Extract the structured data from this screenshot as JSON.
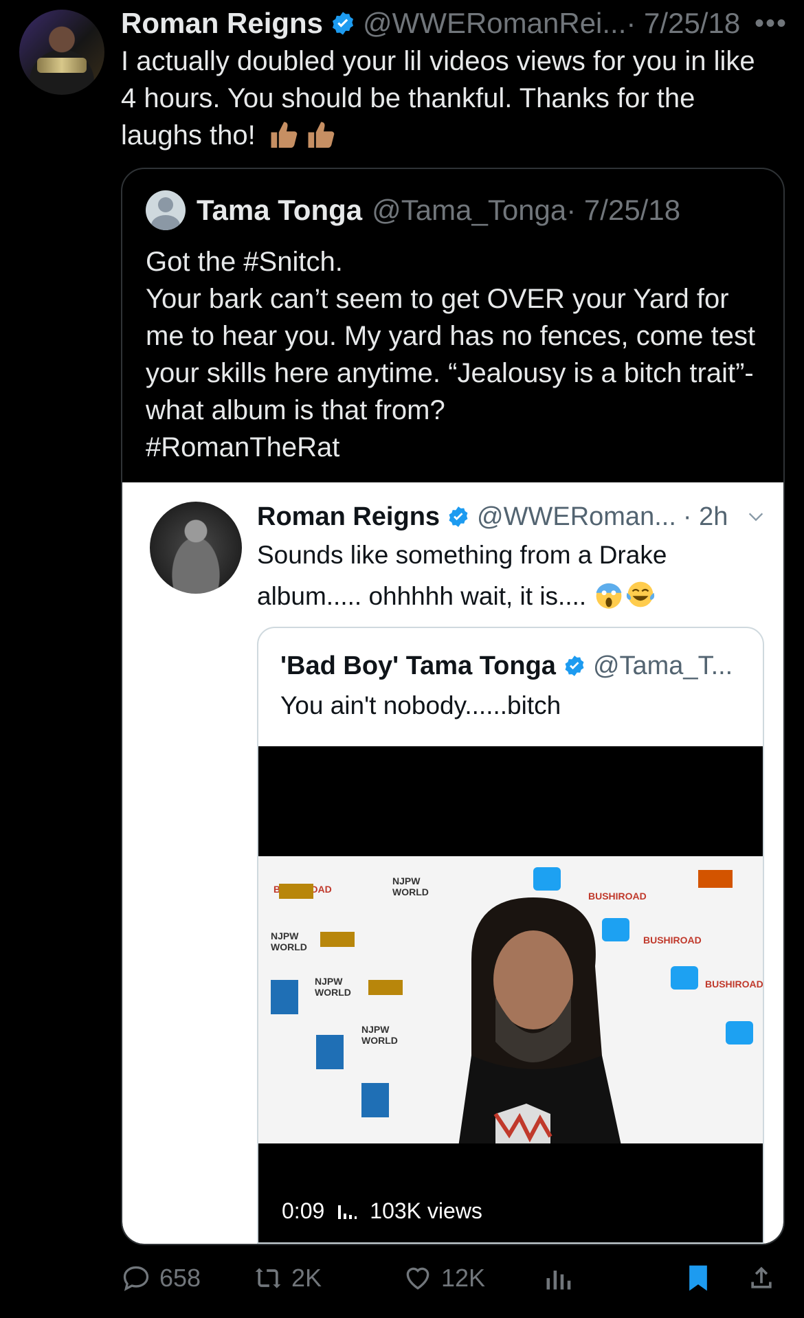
{
  "tweet": {
    "author_name": "Roman Reigns",
    "handle": "@WWERomanRei...",
    "date": "· 7/25/18",
    "more": "•••",
    "text": "I actually doubled your lil videos views for you in like 4 hours.  You should be thankful. Thanks for the laughs tho!",
    "emoji": [
      "thumbs-up-icon",
      "thumbs-up-icon"
    ]
  },
  "quote": {
    "author_name": "Tama Tonga",
    "handle": "@Tama_Tonga",
    "date": "· 7/25/18",
    "lines": [
      "Got the #Snitch.",
      "Your bark can’t seem to get OVER your Yard for me to hear you. My yard has no fences, come test your skills here anytime. “Jealousy is a bitch trait”- what album is that from?",
      "#RomanTheRat"
    ]
  },
  "embed": {
    "author_name": "Roman Reigns",
    "handle": "@WWERoman...",
    "time": "· 2h",
    "text": "Sounds like something from a Drake album..... ohhhhh wait, it is....",
    "inner": {
      "author_name": "'Bad Boy' Tama Tonga",
      "handle": "@Tama_T...",
      "text": "You ain't nobody......bitch"
    },
    "video": {
      "duration": "0:09",
      "views": "103K views",
      "backdrop_labels": [
        "NJPW",
        "WORLD",
        "BUSHIROAD"
      ]
    }
  },
  "actions": {
    "replies": "658",
    "retweets": "2K",
    "likes": "12K"
  },
  "colors": {
    "verified": "#1d9bf0",
    "bookmark": "#1d9bf0",
    "muted": "#71767b"
  }
}
